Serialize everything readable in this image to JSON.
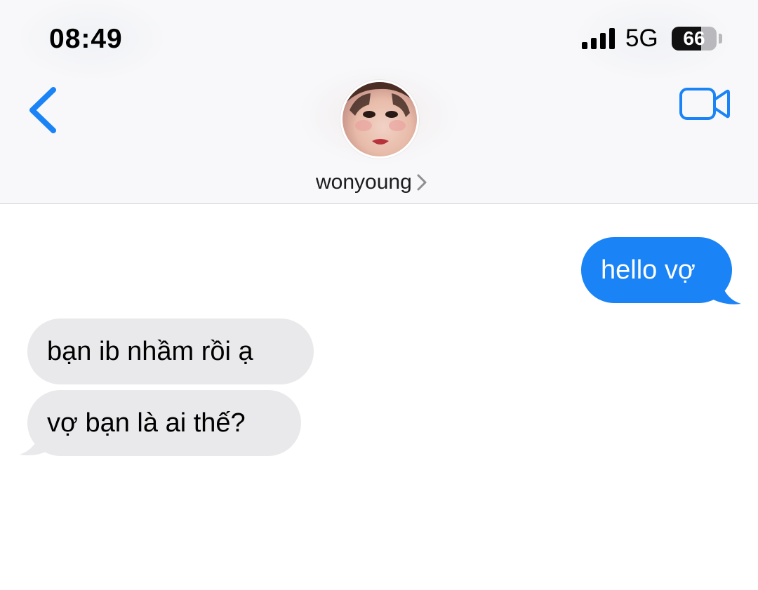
{
  "status_bar": {
    "time": "08:49",
    "network": "5G",
    "battery": "66",
    "icons": [
      "signal-bars-icon",
      "battery-icon"
    ]
  },
  "header": {
    "back_icon": "chevron-left-icon",
    "contact_name": "wonyoung",
    "contact_chevron": "chevron-right-icon",
    "video_icon": "video-camera-icon",
    "accent_color": "#1a83f5"
  },
  "messages": [
    {
      "direction": "outgoing",
      "text": "hello vợ",
      "color": "#1a83f5"
    },
    {
      "direction": "incoming",
      "text": "bạn ib nhầm rồi ạ",
      "color": "#e9e9eb"
    },
    {
      "direction": "incoming",
      "text": "vợ bạn là ai thế?",
      "color": "#e9e9eb"
    }
  ]
}
